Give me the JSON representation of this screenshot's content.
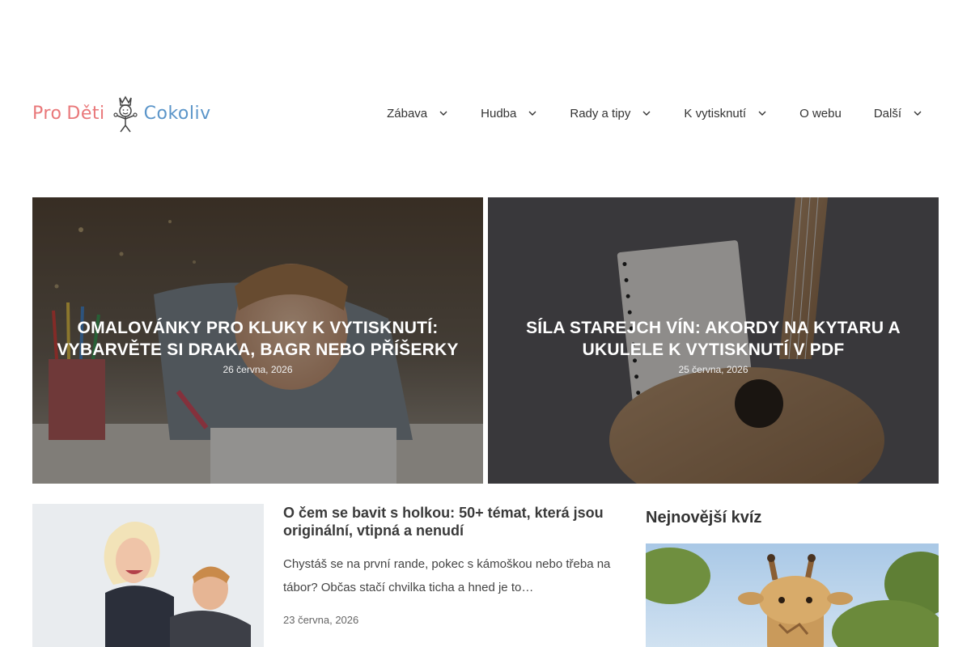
{
  "header": {
    "logo": {
      "word1": "Pro",
      "word2": "Děti",
      "word3": "Cokoliv"
    },
    "nav": [
      {
        "label": "Zábava",
        "has_dropdown": true
      },
      {
        "label": "Hudba",
        "has_dropdown": true
      },
      {
        "label": "Rady a tipy",
        "has_dropdown": true
      },
      {
        "label": "K vytisknutí",
        "has_dropdown": true
      },
      {
        "label": "O webu",
        "has_dropdown": false
      },
      {
        "label": "Další",
        "has_dropdown": true
      }
    ]
  },
  "hero": [
    {
      "title": "Omalovánky pro kluky k vytisknutí: Vybarvěte si draka, bagr nebo příšerky",
      "date": "26 června, 2026"
    },
    {
      "title": "Síla starejch vín: Akordy na kytaru a ukulele k vytisknutí v PDF",
      "date": "25 června, 2026"
    }
  ],
  "posts": [
    {
      "title": "O čem se bavit s holkou: 50+ témat, která jsou originální, vtipná a nenudí",
      "excerpt": "Chystáš se na první rande, pokec s kámoškou nebo třeba na tábor? Občas stačí chvilka ticha a hned je to…",
      "date": "23 června, 2026"
    }
  ],
  "sidebar": {
    "quiz_title": "Nejnovější kvíz"
  },
  "colors": {
    "logo_pink": "#e9787a",
    "logo_blue": "#5b95c9",
    "text_dark": "#333333"
  }
}
